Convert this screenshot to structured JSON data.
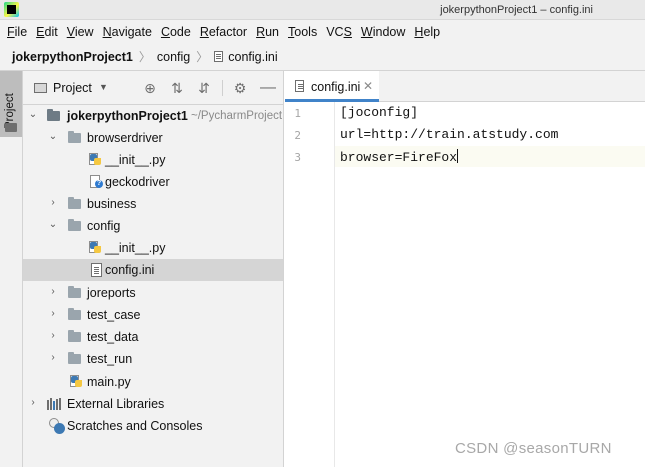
{
  "window": {
    "title": "jokerpythonProject1 – config.ini",
    "logo_text": "PC"
  },
  "menu": [
    {
      "mnemonic": "F",
      "rest": "ile"
    },
    {
      "mnemonic": "E",
      "rest": "dit"
    },
    {
      "mnemonic": "V",
      "rest": "iew"
    },
    {
      "mnemonic": "N",
      "rest": "avigate"
    },
    {
      "mnemonic": "C",
      "rest": "ode"
    },
    {
      "mnemonic": "R",
      "rest": "efactor"
    },
    {
      "mnemonic": "R",
      "rest": "un",
      "pre": ""
    },
    {
      "mnemonic": "T",
      "rest": "ools"
    },
    {
      "pre": "VC",
      "mnemonic": "S",
      "rest": ""
    },
    {
      "mnemonic": "W",
      "rest": "indow"
    },
    {
      "mnemonic": "H",
      "rest": "elp"
    }
  ],
  "breadcrumb": {
    "project": "jokerpythonProject1",
    "folder": "config",
    "file": "config.ini"
  },
  "toolstrip": {
    "tab_label": "Project"
  },
  "project_panel": {
    "view_label": "Project",
    "icons": [
      "locate-icon",
      "expand-all-icon",
      "collapse-all-icon",
      "gear-icon",
      "hide-icon"
    ]
  },
  "tree": {
    "root_label": "jokerpythonProject1",
    "root_path": "~/PycharmProject",
    "browserdriver": "browserdriver",
    "init_py_1": "__init__.py",
    "geckodriver": "geckodriver",
    "business": "business",
    "config": "config",
    "init_py_2": "__init__.py",
    "config_ini": "config.ini",
    "joreports": "joreports",
    "test_case": "test_case",
    "test_data": "test_data",
    "test_run": "test_run",
    "main_py": "main.py",
    "external_libraries": "External Libraries",
    "scratches": "Scratches and Consoles"
  },
  "editor": {
    "tab_label": "config.ini",
    "lines": [
      {
        "num": "1",
        "text": "[joconfig]"
      },
      {
        "num": "2",
        "text": "url=http://train.atstudy.com"
      },
      {
        "num": "3",
        "text": "browser=FireFox"
      }
    ]
  },
  "watermark": "CSDN @seasonTURN"
}
